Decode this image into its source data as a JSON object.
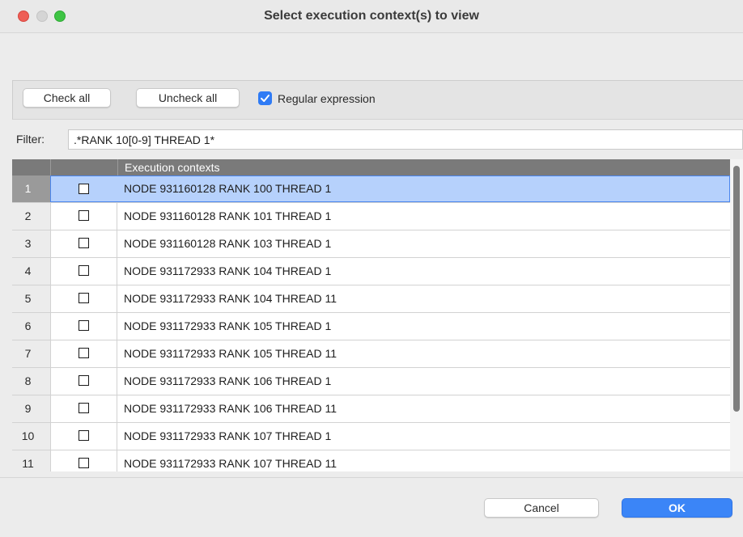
{
  "window": {
    "title": "Select execution context(s) to view"
  },
  "toolbar": {
    "check_all_label": "Check all",
    "uncheck_all_label": "Uncheck all",
    "regex_label": "Regular expression",
    "regex_checked": true
  },
  "filter": {
    "label": "Filter:",
    "value": ".*RANK 10[0-9] THREAD 1*"
  },
  "table": {
    "columns": [
      "",
      "",
      "Execution contexts"
    ],
    "selected_row": 1,
    "rows": [
      {
        "num": "1",
        "checked": false,
        "context": "NODE 931160128 RANK 100 THREAD 1"
      },
      {
        "num": "2",
        "checked": false,
        "context": "NODE 931160128 RANK 101 THREAD 1"
      },
      {
        "num": "3",
        "checked": false,
        "context": "NODE 931160128 RANK 103 THREAD 1"
      },
      {
        "num": "4",
        "checked": false,
        "context": "NODE 931172933 RANK 104 THREAD 1"
      },
      {
        "num": "5",
        "checked": false,
        "context": "NODE 931172933 RANK 104 THREAD 11"
      },
      {
        "num": "6",
        "checked": false,
        "context": "NODE 931172933 RANK 105 THREAD 1"
      },
      {
        "num": "7",
        "checked": false,
        "context": "NODE 931172933 RANK 105 THREAD 11"
      },
      {
        "num": "8",
        "checked": false,
        "context": "NODE 931172933 RANK 106 THREAD 1"
      },
      {
        "num": "9",
        "checked": false,
        "context": "NODE 931172933 RANK 106 THREAD 11"
      },
      {
        "num": "10",
        "checked": false,
        "context": "NODE 931172933 RANK 107 THREAD 1"
      },
      {
        "num": "11",
        "checked": false,
        "context": "NODE 931172933 RANK 107 THREAD 11"
      }
    ]
  },
  "footer": {
    "cancel_label": "Cancel",
    "ok_label": "OK"
  },
  "colors": {
    "accent": "#3b85f7",
    "selected_row": "#b6d1fc",
    "header_bg": "#7a7a7a",
    "close": "#ee5e56",
    "maximize": "#3ec444"
  }
}
